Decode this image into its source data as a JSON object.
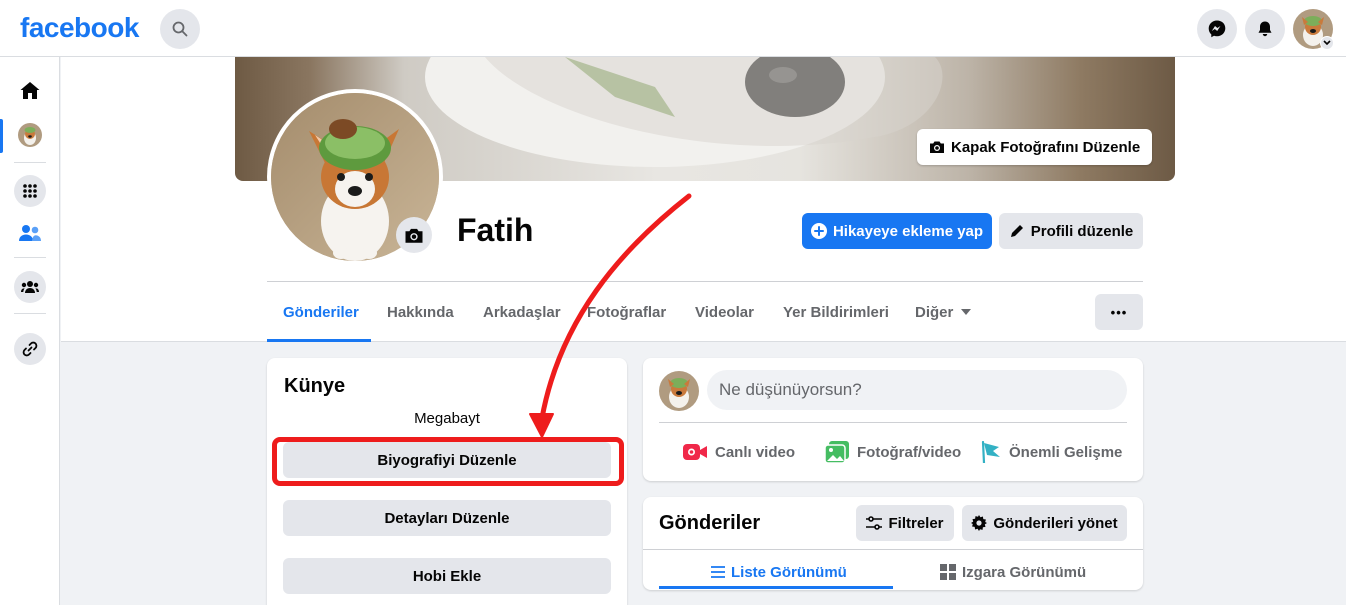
{
  "topbar": {
    "logo": "facebook",
    "search_icon": "search-icon",
    "messenger_icon": "messenger-icon",
    "notifications_icon": "bell-icon"
  },
  "rail": {
    "items": [
      "home-icon",
      "profile-avatar",
      "menu-grid-icon",
      "friends-icon",
      "groups-icon",
      "link-icon"
    ]
  },
  "profile": {
    "name": "Fatih",
    "edit_cover_label": "Kapak Fotoğrafını Düzenle",
    "add_story_label": "Hikayeye ekleme yap",
    "edit_profile_label": "Profili düzenle",
    "tabs": [
      "Gönderiler",
      "Hakkında",
      "Arkadaşlar",
      "Fotoğraflar",
      "Videolar",
      "Yer Bildirimleri",
      "Diğer"
    ],
    "active_tab": "Gönderiler",
    "more_label": "•••"
  },
  "intro": {
    "title": "Künye",
    "bio": "Megabayt",
    "edit_bio_label": "Biyografiyi Düzenle",
    "edit_details_label": "Detayları Düzenle",
    "add_hobby_label": "Hobi Ekle"
  },
  "composer": {
    "placeholder": "Ne düşünüyorsun?",
    "live_video_label": "Canlı video",
    "photo_video_label": "Fotoğraf/video",
    "life_event_label": "Önemli Gelişme"
  },
  "posts": {
    "title": "Gönderiler",
    "filters_label": "Filtreler",
    "manage_label": "Gönderileri yönet",
    "list_view_label": "Liste Görünümü",
    "grid_view_label": "Izgara Görünümü"
  },
  "colors": {
    "brand": "#1877f2",
    "annotation": "#ee1c1c"
  }
}
